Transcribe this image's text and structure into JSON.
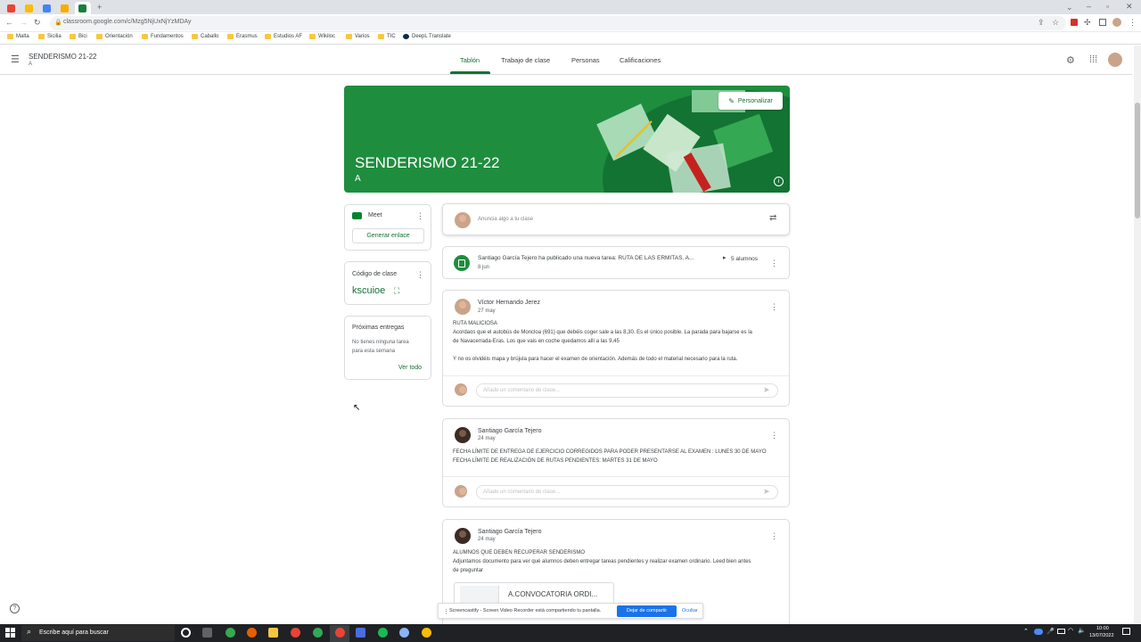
{
  "browser": {
    "url": "classroom.google.com/c/Mzg5NjUxNjYzMDAy",
    "bookmarks": [
      "Malta",
      "Sicilia",
      "Bici",
      "Orientación",
      "Fundamentos",
      "Caballo",
      "Erasmus",
      "Estudios AF",
      "Wikiloc",
      "Varios",
      "TIC",
      "DeepL Translate"
    ]
  },
  "header": {
    "class_title": "SENDERISMO 21-22",
    "class_subtitle": "A",
    "tabs": [
      "Tablón",
      "Trabajo de clase",
      "Personas",
      "Calificaciones"
    ]
  },
  "banner": {
    "title": "SENDERISMO 21-22",
    "subtitle": "A",
    "personalize_label": "Personalizar",
    "color": "#1e8e3e"
  },
  "meet": {
    "label": "Meet",
    "generate_link_label": "Generar enlace"
  },
  "class_code": {
    "label": "Código de clase",
    "code": "kscuioe"
  },
  "upcoming": {
    "title": "Próximas entregas",
    "empty_text_1": "No tienes ninguna tarea",
    "empty_text_2": "para esta semana",
    "view_all": "Ver todo"
  },
  "announce": {
    "placeholder": "Anuncia algo a tu clase"
  },
  "task_notice": {
    "text": "Santiago García Tejero ha publicado una nueva tarea: RUTA DE LAS ERMITAS. A...",
    "date": "8 jun",
    "students": "5 alumnos"
  },
  "posts": [
    {
      "author": "Víctor Hernando Jerez",
      "date": "27 may",
      "lines": [
        "RUTA MALICIOSA",
        "Acordaos que el autobús de Moncloa (691) que debéis coger sale a las 8,30. Es el único posible. La parada para bajarse es la",
        "de Navacerrada-Eras. Los que vais en coche quedamos allí a las 9,45",
        "",
        "Y no os olvidéis mapa y brújula para hacer el examen de orientación. Además de todo el material necesario para la ruta."
      ],
      "comment_placeholder": "Añade un comentario de clase..."
    },
    {
      "author": "Santiago García Tejero",
      "date": "24 may",
      "lines": [
        "FECHA LÍMITE DE ENTREGA DE EJERCICIO CORREGIDOS PARA PODER PRESENTARSE AL EXAMEN : LUNES 30 DE MAYO",
        "FECHA LÍMITE DE REALIZACIÓN DE RUTAS PENDIENTES: MARTES 31 DE MAYO"
      ],
      "comment_placeholder": "Añade un comentario de clase..."
    },
    {
      "author": "Santiago García Tejero",
      "date": "24 may",
      "lines": [
        "ALUMNOS QUE DEBEN RECUPERAR SENDERISMO",
        "Adjuntamos documento para ver qué alumnos deben entregar tareas pendientes y realizar examen ordinario. Leed bien antes",
        "de preguntar"
      ],
      "attachment": "A.CONVOCATORIA ORDI..."
    }
  ],
  "share_bar": {
    "text": "Screencastify - Screen Video Recorder está compartiendo tu pantalla.",
    "stop_label": "Dejar de compartir",
    "hide_label": "Ocultar"
  },
  "taskbar": {
    "search_placeholder": "Escribe aquí para buscar",
    "time": "10:00",
    "date": "13/07/2022"
  }
}
